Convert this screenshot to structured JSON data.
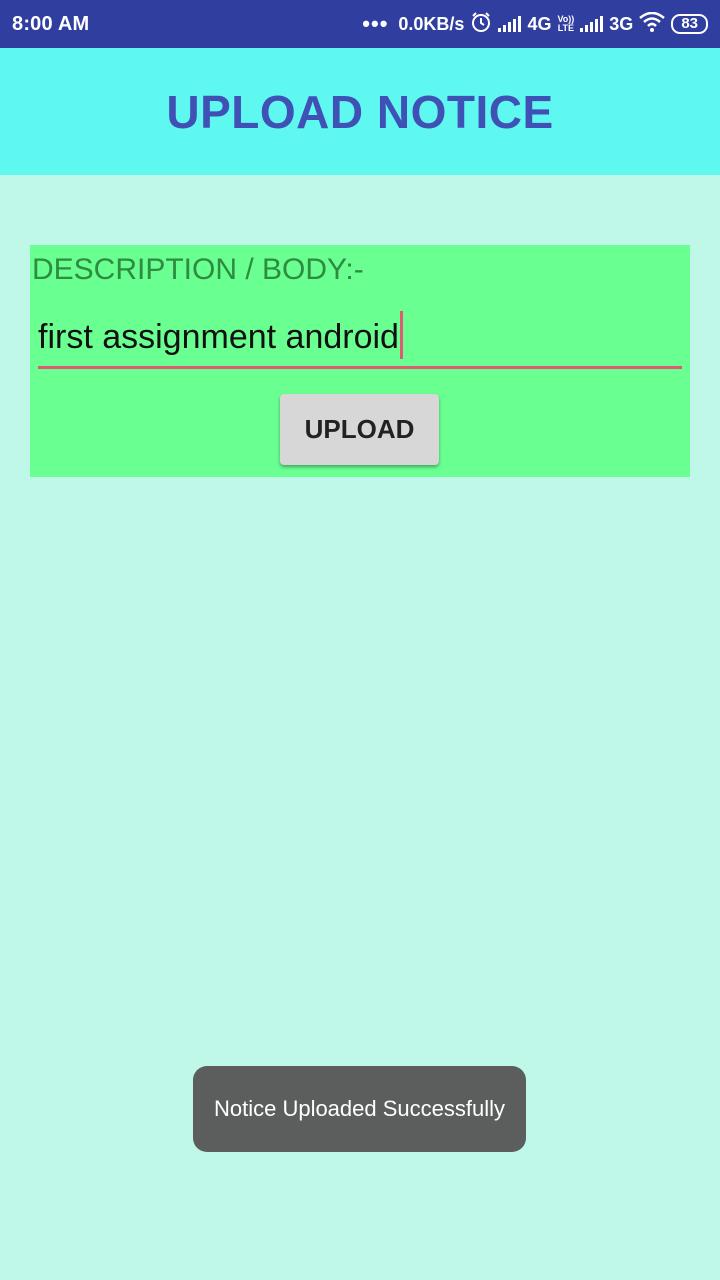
{
  "status_bar": {
    "time": "8:00 AM",
    "more": "•••",
    "speed": "0.0KB/s",
    "net1": "4G",
    "volte_top": "Vo))",
    "volte_bottom": "LTE",
    "net2": "3G",
    "battery": "83"
  },
  "app_bar": {
    "title": "UPLOAD NOTICE"
  },
  "form": {
    "label": "DESCRIPTION / BODY:-",
    "description_value": "first assignment android",
    "upload_label": "UPLOAD"
  },
  "toast": {
    "message": "Notice Uploaded Successfully"
  },
  "colors": {
    "status_bar": "#303f9f",
    "app_bar": "#5ef8f0",
    "title": "#3f51b5",
    "background": "#bff8e8",
    "panel": "#69ff91",
    "accent": "#e05a74"
  }
}
